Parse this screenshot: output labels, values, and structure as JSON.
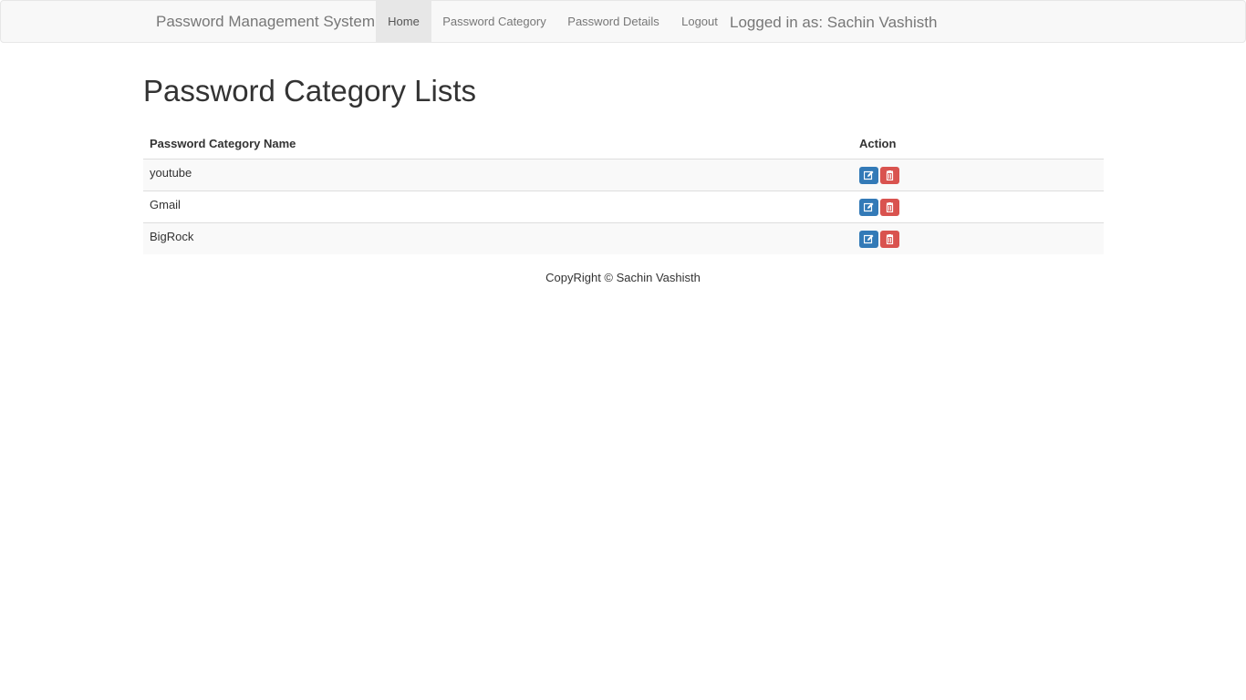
{
  "navbar": {
    "brand": "Password Management System",
    "items": [
      {
        "label": "Home",
        "active": true
      },
      {
        "label": "Password Category",
        "active": false
      },
      {
        "label": "Password Details",
        "active": false
      },
      {
        "label": "Logout",
        "active": false
      }
    ],
    "logged_in": "Logged in as: Sachin Vashisth"
  },
  "main": {
    "title": "Password Category Lists",
    "table": {
      "headers": [
        "Password Category Name",
        "Action"
      ],
      "rows": [
        {
          "name": "youtube",
          "actions": [
            "edit-icon",
            "trash-icon"
          ]
        },
        {
          "name": "Gmail",
          "actions": [
            "edit-icon",
            "trash-icon"
          ]
        },
        {
          "name": "BigRock",
          "actions": [
            "edit-icon",
            "trash-icon"
          ]
        }
      ]
    }
  },
  "footer": {
    "text": "CopyRight © Sachin Vashisth"
  },
  "colors": {
    "edit_button": "#337ab7",
    "delete_button": "#d9534f",
    "navbar_bg": "#f8f8f8"
  }
}
